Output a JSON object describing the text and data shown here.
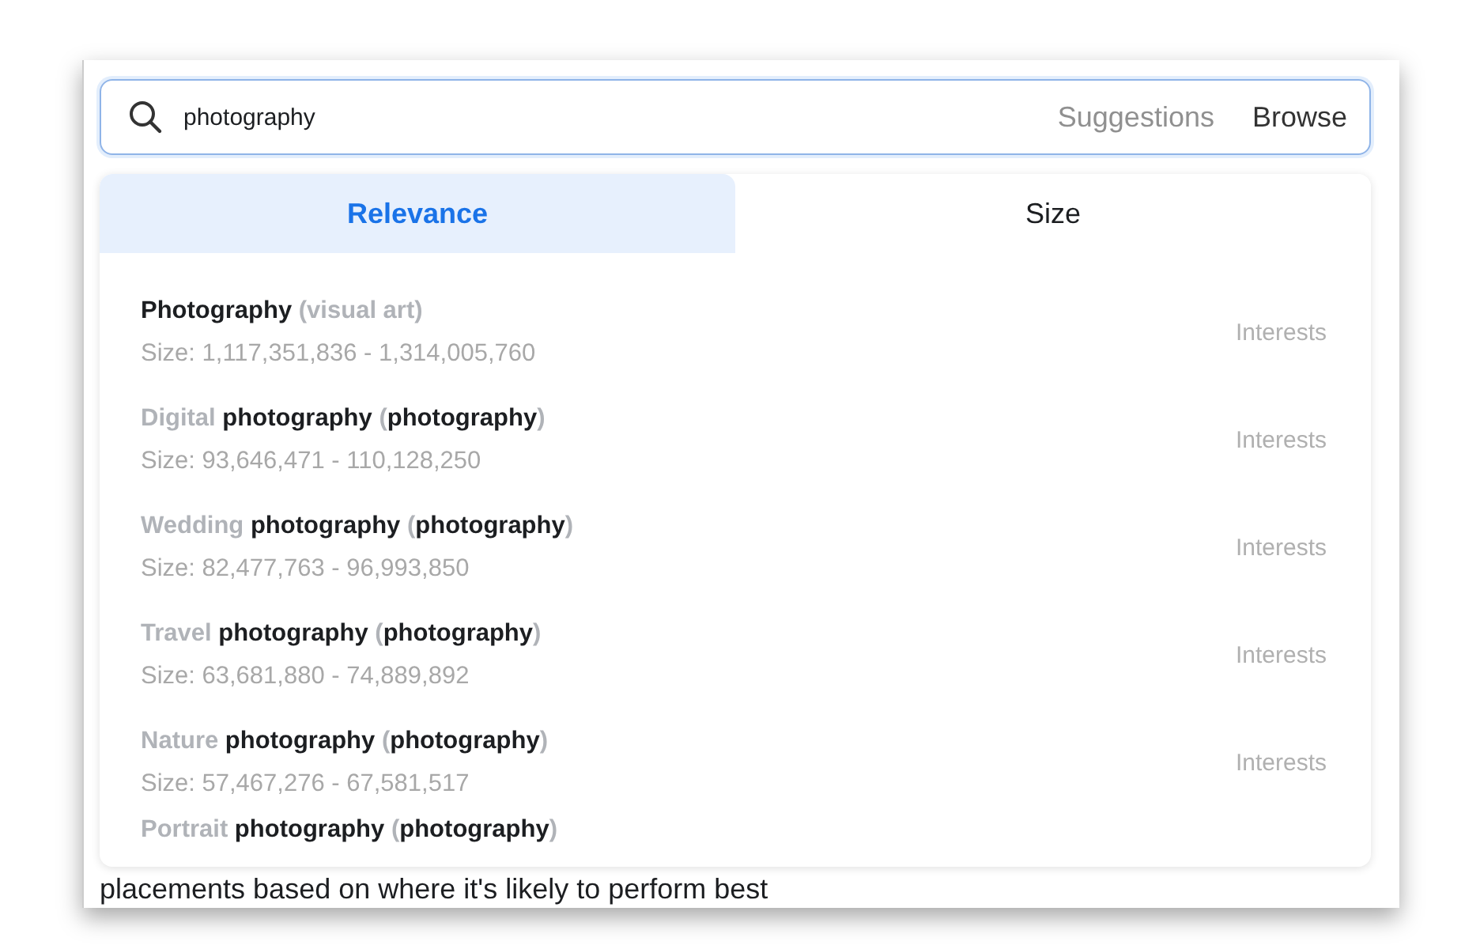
{
  "search": {
    "value": "photography",
    "modes": [
      {
        "label": "Suggestions",
        "selected": false
      },
      {
        "label": "Browse",
        "selected": true
      }
    ]
  },
  "tabs": [
    {
      "label": "Relevance",
      "selected": true
    },
    {
      "label": "Size",
      "selected": false
    }
  ],
  "results": [
    {
      "name_parts": [
        {
          "text": "Photography",
          "matched": true
        },
        {
          "text": " (visual art)",
          "matched": false
        }
      ],
      "size": "Size: 1,117,351,836 - 1,314,005,760",
      "category": "Interests"
    },
    {
      "name_parts": [
        {
          "text": "Digital",
          "matched": false
        },
        {
          "text": " photography",
          "matched": true
        },
        {
          "text": " (",
          "matched": false
        },
        {
          "text": "photography",
          "matched": true
        },
        {
          "text": ")",
          "matched": false
        }
      ],
      "size": "Size: 93,646,471 - 110,128,250",
      "category": "Interests"
    },
    {
      "name_parts": [
        {
          "text": "Wedding",
          "matched": false
        },
        {
          "text": " photography",
          "matched": true
        },
        {
          "text": " (",
          "matched": false
        },
        {
          "text": "photography",
          "matched": true
        },
        {
          "text": ")",
          "matched": false
        }
      ],
      "size": "Size: 82,477,763 - 96,993,850",
      "category": "Interests"
    },
    {
      "name_parts": [
        {
          "text": "Travel",
          "matched": false
        },
        {
          "text": " photography",
          "matched": true
        },
        {
          "text": " (",
          "matched": false
        },
        {
          "text": "photography",
          "matched": true
        },
        {
          "text": ")",
          "matched": false
        }
      ],
      "size": "Size: 63,681,880 - 74,889,892",
      "category": "Interests"
    },
    {
      "name_parts": [
        {
          "text": "Nature",
          "matched": false
        },
        {
          "text": " photography",
          "matched": true
        },
        {
          "text": " (",
          "matched": false
        },
        {
          "text": "photography",
          "matched": true
        },
        {
          "text": ")",
          "matched": false
        }
      ],
      "size": "Size: 57,467,276 - 67,581,517",
      "category": "Interests"
    },
    {
      "name_parts": [
        {
          "text": "Portrait",
          "matched": false
        },
        {
          "text": " photography",
          "matched": true
        },
        {
          "text": " (",
          "matched": false
        },
        {
          "text": "photography",
          "matched": true
        },
        {
          "text": ")",
          "matched": false
        }
      ]
    }
  ],
  "background_text": "placements based on where it's likely to perform best"
}
